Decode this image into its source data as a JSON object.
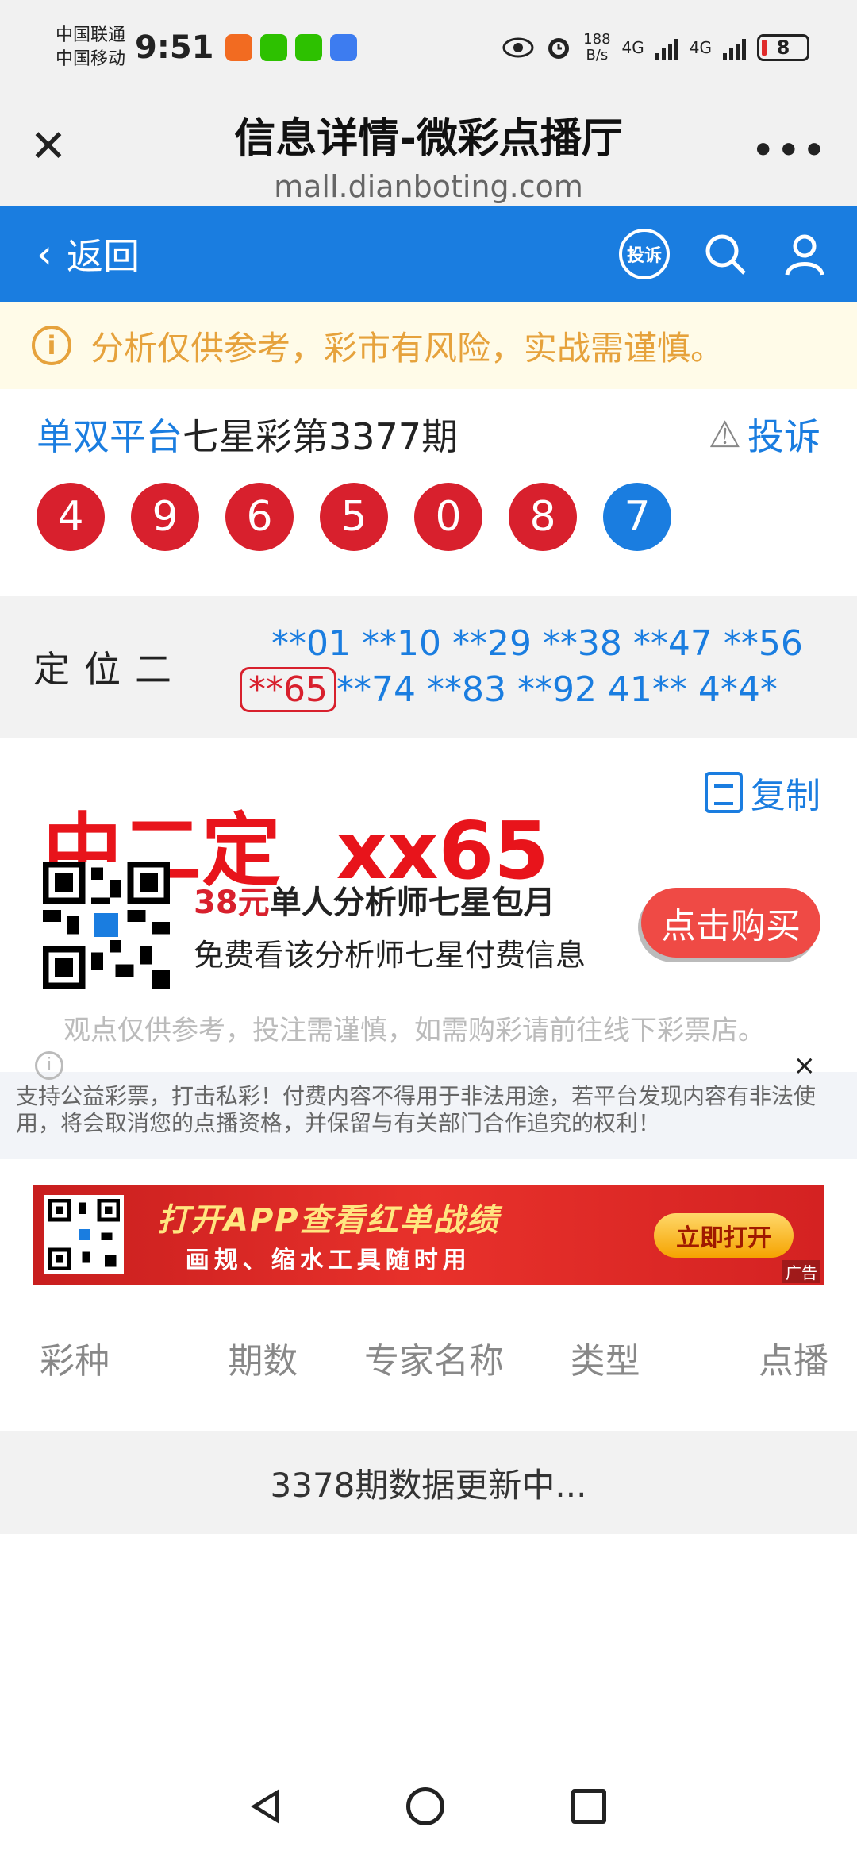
{
  "status_bar": {
    "carrier1": "中国联通",
    "carrier2": "中国移动",
    "time": "9:51",
    "net_speed_value": "188",
    "net_speed_unit": "B/s",
    "net1": "4G",
    "net2": "4G",
    "battery": "8"
  },
  "titlebar": {
    "title": "信息详情-微彩点播厅",
    "url": "mall.dianboting.com",
    "close_icon": "close-icon",
    "more": "•••"
  },
  "nav": {
    "back_label": "返回",
    "complain_badge": "投诉"
  },
  "notice": {
    "icon": "i",
    "text": "分析仅供参考，彩市有风险，实战需谨慎。"
  },
  "issue": {
    "platform": "单双平台",
    "title": "七星彩第3377期",
    "complain_label": "投诉",
    "balls": [
      "4",
      "9",
      "6",
      "5",
      "0",
      "8",
      "7"
    ]
  },
  "dingwei": {
    "label": "定位二",
    "line1": "**01 **10 **29 **38 **47 **56",
    "highlight": "**65",
    "line2_rest": "**74 **83 **92 41** 4*4*"
  },
  "pick": {
    "label": "中二定  xx65",
    "copy_label": "复制"
  },
  "promo": {
    "price": "38元",
    "title": "单人分析师七星包月",
    "subtitle": "免费看该分析师七星付费信息",
    "buy_label": "点击购买"
  },
  "disclaimer": {
    "text": "观点仅供参考，投注需谨慎，如需购彩请前往线下彩票店。",
    "info_icon": "i",
    "close": "×"
  },
  "law_text": "支持公益彩票，打击私彩！付费内容不得用于非法用途，若平台发现内容有非法使用，将会取消您的点播资格，并保留与有关部门合作追究的权利！",
  "banner": {
    "line1": "打开APP查看红单战绩",
    "line2": "画规、缩水工具随时用",
    "open_label": "立即打开",
    "ad_label": "广告"
  },
  "table": {
    "headers": [
      "彩种",
      "期数",
      "专家名称",
      "类型",
      "点播"
    ],
    "status": "3378期数据更新中..."
  },
  "colors": {
    "brand_blue": "#1a7de0",
    "ball_red": "#d8202d",
    "pick_red": "#e8141b",
    "notice_orange": "#e6a23c"
  }
}
